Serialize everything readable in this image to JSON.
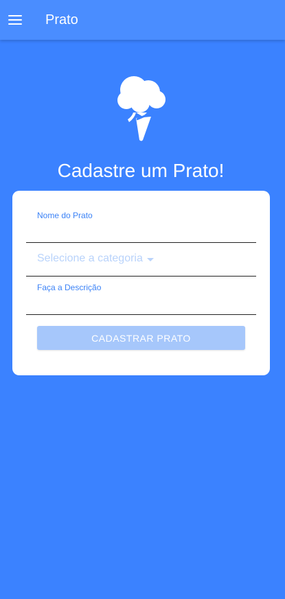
{
  "appbar": {
    "title": "Prato",
    "menu_icon": "menu-icon"
  },
  "hero": {
    "icon": "ice-cream-icon",
    "headline": "Cadastre um Prato!"
  },
  "form": {
    "name_label": "Nome do Prato",
    "name_value": "",
    "category_placeholder": "Selecione a categoria",
    "description_label": "Faça a Descrição",
    "description_value": "",
    "submit_label": "CADASTRAR PRATO"
  },
  "colors": {
    "background": "#3b82ff",
    "appbar": "#4a8dff",
    "label": "#3b82f6",
    "button_disabled": "#a6c7fb"
  }
}
